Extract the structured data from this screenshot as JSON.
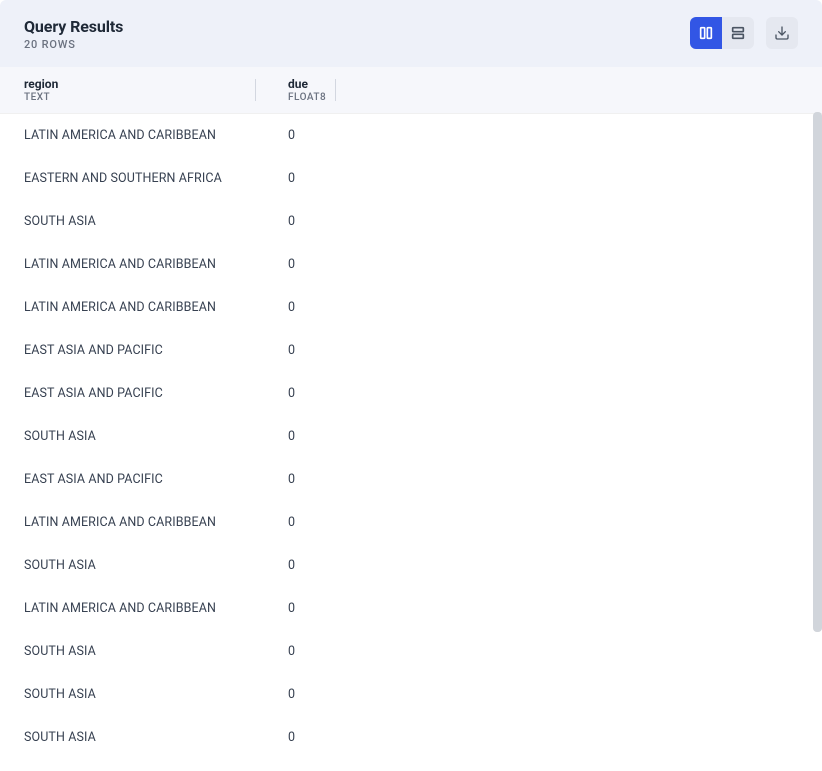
{
  "header": {
    "title": "Query Results",
    "row_count": "20 ROWS"
  },
  "columns": [
    {
      "name": "region",
      "type": "TEXT"
    },
    {
      "name": "due",
      "type": "FLOAT8"
    }
  ],
  "rows": [
    {
      "region": "LATIN AMERICA AND CARIBBEAN",
      "due": "0"
    },
    {
      "region": "EASTERN AND SOUTHERN AFRICA",
      "due": "0"
    },
    {
      "region": "SOUTH ASIA",
      "due": "0"
    },
    {
      "region": "LATIN AMERICA AND CARIBBEAN",
      "due": "0"
    },
    {
      "region": "LATIN AMERICA AND CARIBBEAN",
      "due": "0"
    },
    {
      "region": "EAST ASIA AND PACIFIC",
      "due": "0"
    },
    {
      "region": "EAST ASIA AND PACIFIC",
      "due": "0"
    },
    {
      "region": "SOUTH ASIA",
      "due": "0"
    },
    {
      "region": "EAST ASIA AND PACIFIC",
      "due": "0"
    },
    {
      "region": "LATIN AMERICA AND CARIBBEAN",
      "due": "0"
    },
    {
      "region": "SOUTH ASIA",
      "due": "0"
    },
    {
      "region": "LATIN AMERICA AND CARIBBEAN",
      "due": "0"
    },
    {
      "region": "SOUTH ASIA",
      "due": "0"
    },
    {
      "region": "SOUTH ASIA",
      "due": "0"
    },
    {
      "region": "SOUTH ASIA",
      "due": "0"
    }
  ]
}
